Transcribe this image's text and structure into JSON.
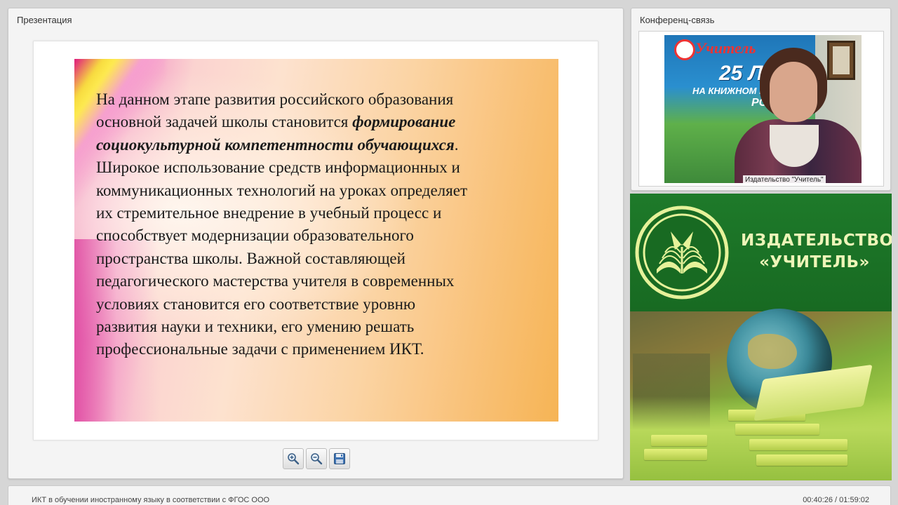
{
  "presentation": {
    "title": "Презентация",
    "slide": {
      "line1": "На данном этапе развития российского образования",
      "line2_plain": "основной задачей школы становится ",
      "line2_bold": "формирование",
      "line3_bold": "социокультурной компетентности обучающихся",
      "line3_plain": ".",
      "line4": "Широкое использование средств информационных и",
      "line5": "коммуникационных технологий на уроках определяет",
      "line6": "их стремительное внедрение в учебный процесс и",
      "line7": "способствует модернизации образовательного",
      "line8": "пространства школы. Важной составляющей",
      "line9": "педагогического мастерства учителя в современных",
      "line10": "условиях становится его соответствие уровню",
      "line11": "развития науки и техники, его умению решать",
      "line12": "профессиональные задачи с применением ИКТ."
    },
    "toolbar": {
      "zoom_in_icon": "zoom-in-icon",
      "zoom_out_icon": "zoom-out-icon",
      "save_icon": "floppy-disk-icon"
    }
  },
  "conference": {
    "title": "Конференц-связь",
    "video_caption": "Издательство \"Учитель\"",
    "poster": {
      "line1": "Учитель",
      "line2": "25 ЛЕТ",
      "line3": "НА КНИЖНОМ Р",
      "line4": "РОСС"
    }
  },
  "banner": {
    "title_line1": "ИЗДАТЕЛЬСТВО",
    "title_line2": "«УЧИТЕЛЬ»",
    "colors": {
      "green": "#1e7a2a",
      "text": "#eef5b8"
    }
  },
  "footer": {
    "course_title": "ИКТ в обучении иностранному языку в соответствии с ФГОС ООО",
    "time": "00:40:26 / 01:59:02"
  }
}
